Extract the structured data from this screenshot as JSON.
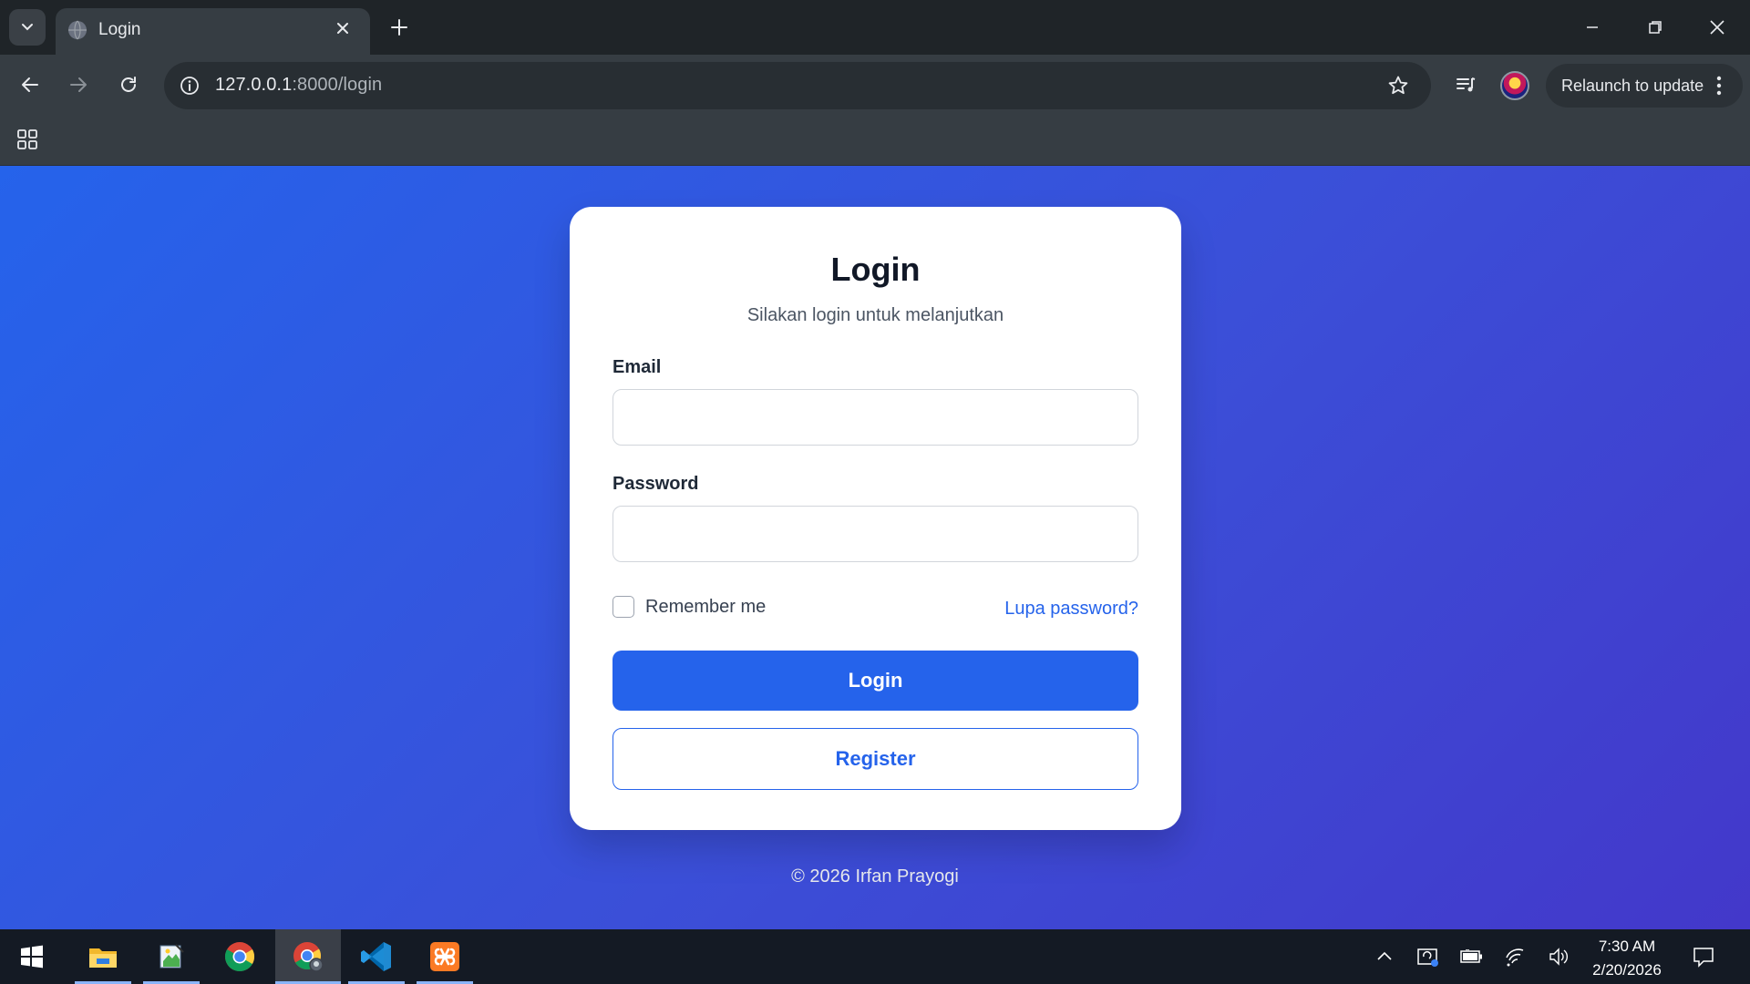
{
  "browser": {
    "tab_title": "Login",
    "url_host": "127.0.0.1",
    "url_rest": ":8000/login",
    "relaunch_label": "Relaunch to update"
  },
  "login": {
    "title": "Login",
    "subtitle": "Silakan login untuk melanjutkan",
    "email_label": "Email",
    "email_value": "",
    "password_label": "Password",
    "password_value": "",
    "remember_label": "Remember me",
    "remember_checked": false,
    "forgot_label": "Lupa password?",
    "login_button": "Login",
    "register_button": "Register",
    "footer": "© 2026 Irfan Prayogi"
  },
  "colors": {
    "primary": "#2563eb",
    "gradient_start": "#2563eb",
    "gradient_end": "#4338ca"
  },
  "taskbar": {
    "apps": [
      "windows-start-icon",
      "file-explorer-icon",
      "notepad-icon",
      "chrome-icon",
      "chrome-profile-icon",
      "vscode-icon",
      "xampp-icon"
    ],
    "time": "7:30 AM",
    "date": "2/20/2026"
  }
}
